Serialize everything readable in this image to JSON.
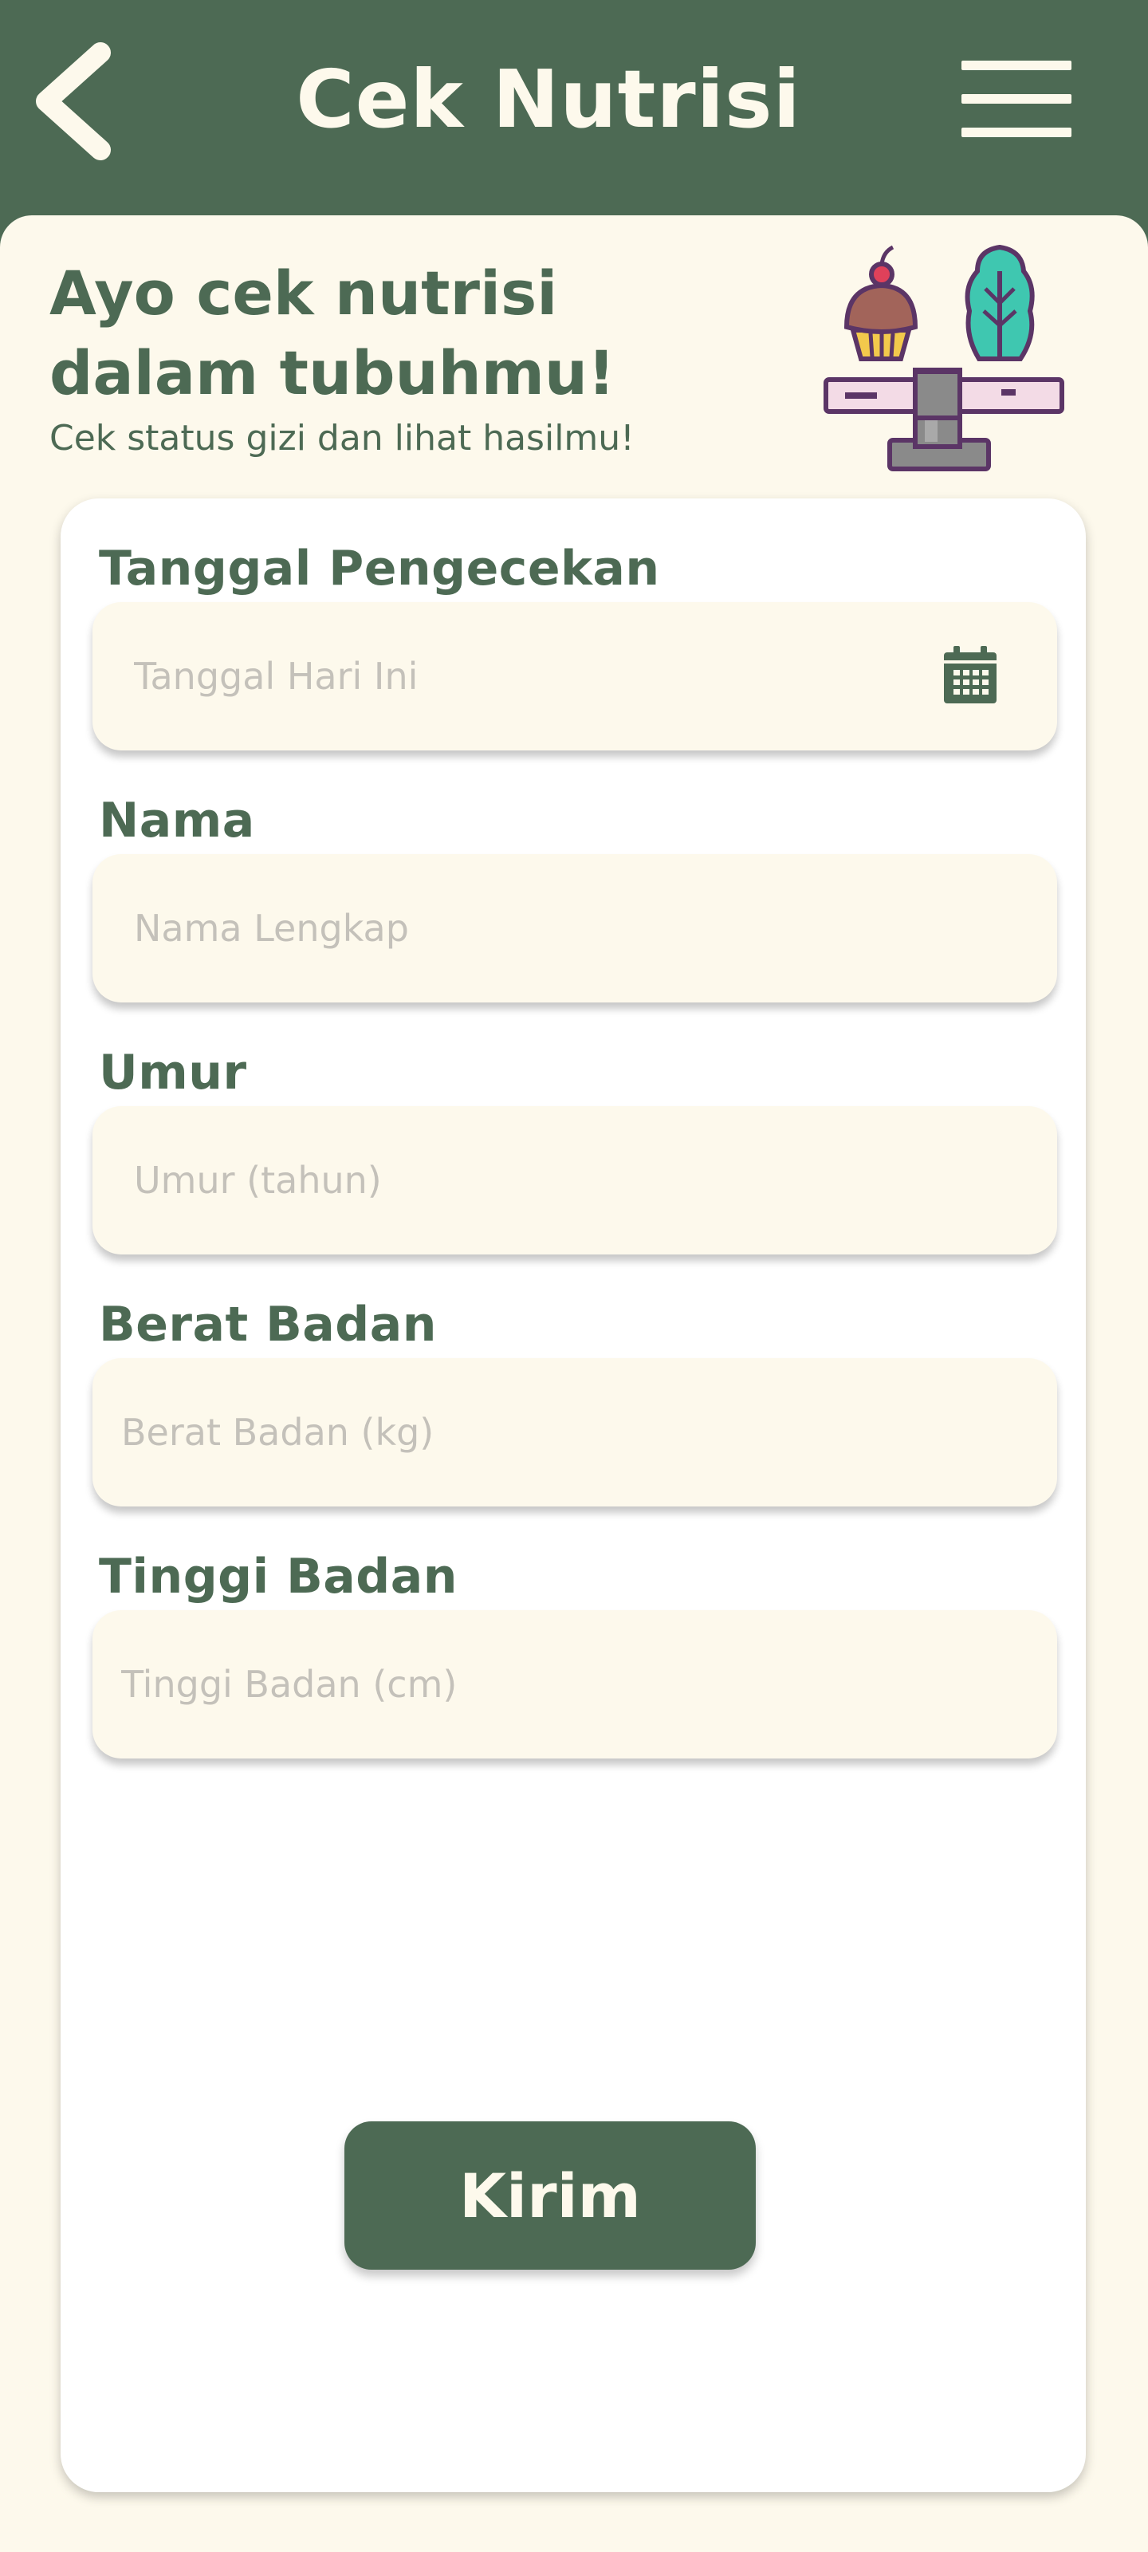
{
  "header": {
    "title": "Cek Nutrisi",
    "back_icon": "chevron-left-icon",
    "menu_icon": "hamburger-menu-icon"
  },
  "intro": {
    "title": "Ayo cek nutrisi dalam tubuhmu!",
    "subtitle": "Cek status gizi dan lihat hasilmu!",
    "illustration": "cupcake-and-vegetable-on-scale-illustration"
  },
  "form": {
    "fields": [
      {
        "label": "Tanggal Pengecekan",
        "placeholder": "Tanggal Hari Ini",
        "icon": "calendar-icon"
      },
      {
        "label": "Nama",
        "placeholder": "Nama Lengkap"
      },
      {
        "label": "Umur",
        "placeholder": "Umur (tahun)"
      },
      {
        "label": "Berat Badan",
        "placeholder": "Berat Badan (kg)"
      },
      {
        "label": "Tinggi Badan",
        "placeholder": "Tinggi Badan (cm)"
      }
    ],
    "submit_label": "Kirim"
  },
  "colors": {
    "primary": "#4d6a54",
    "background": "#fdf9ec",
    "card": "#ffffff",
    "placeholder": "#c4c1ba"
  }
}
